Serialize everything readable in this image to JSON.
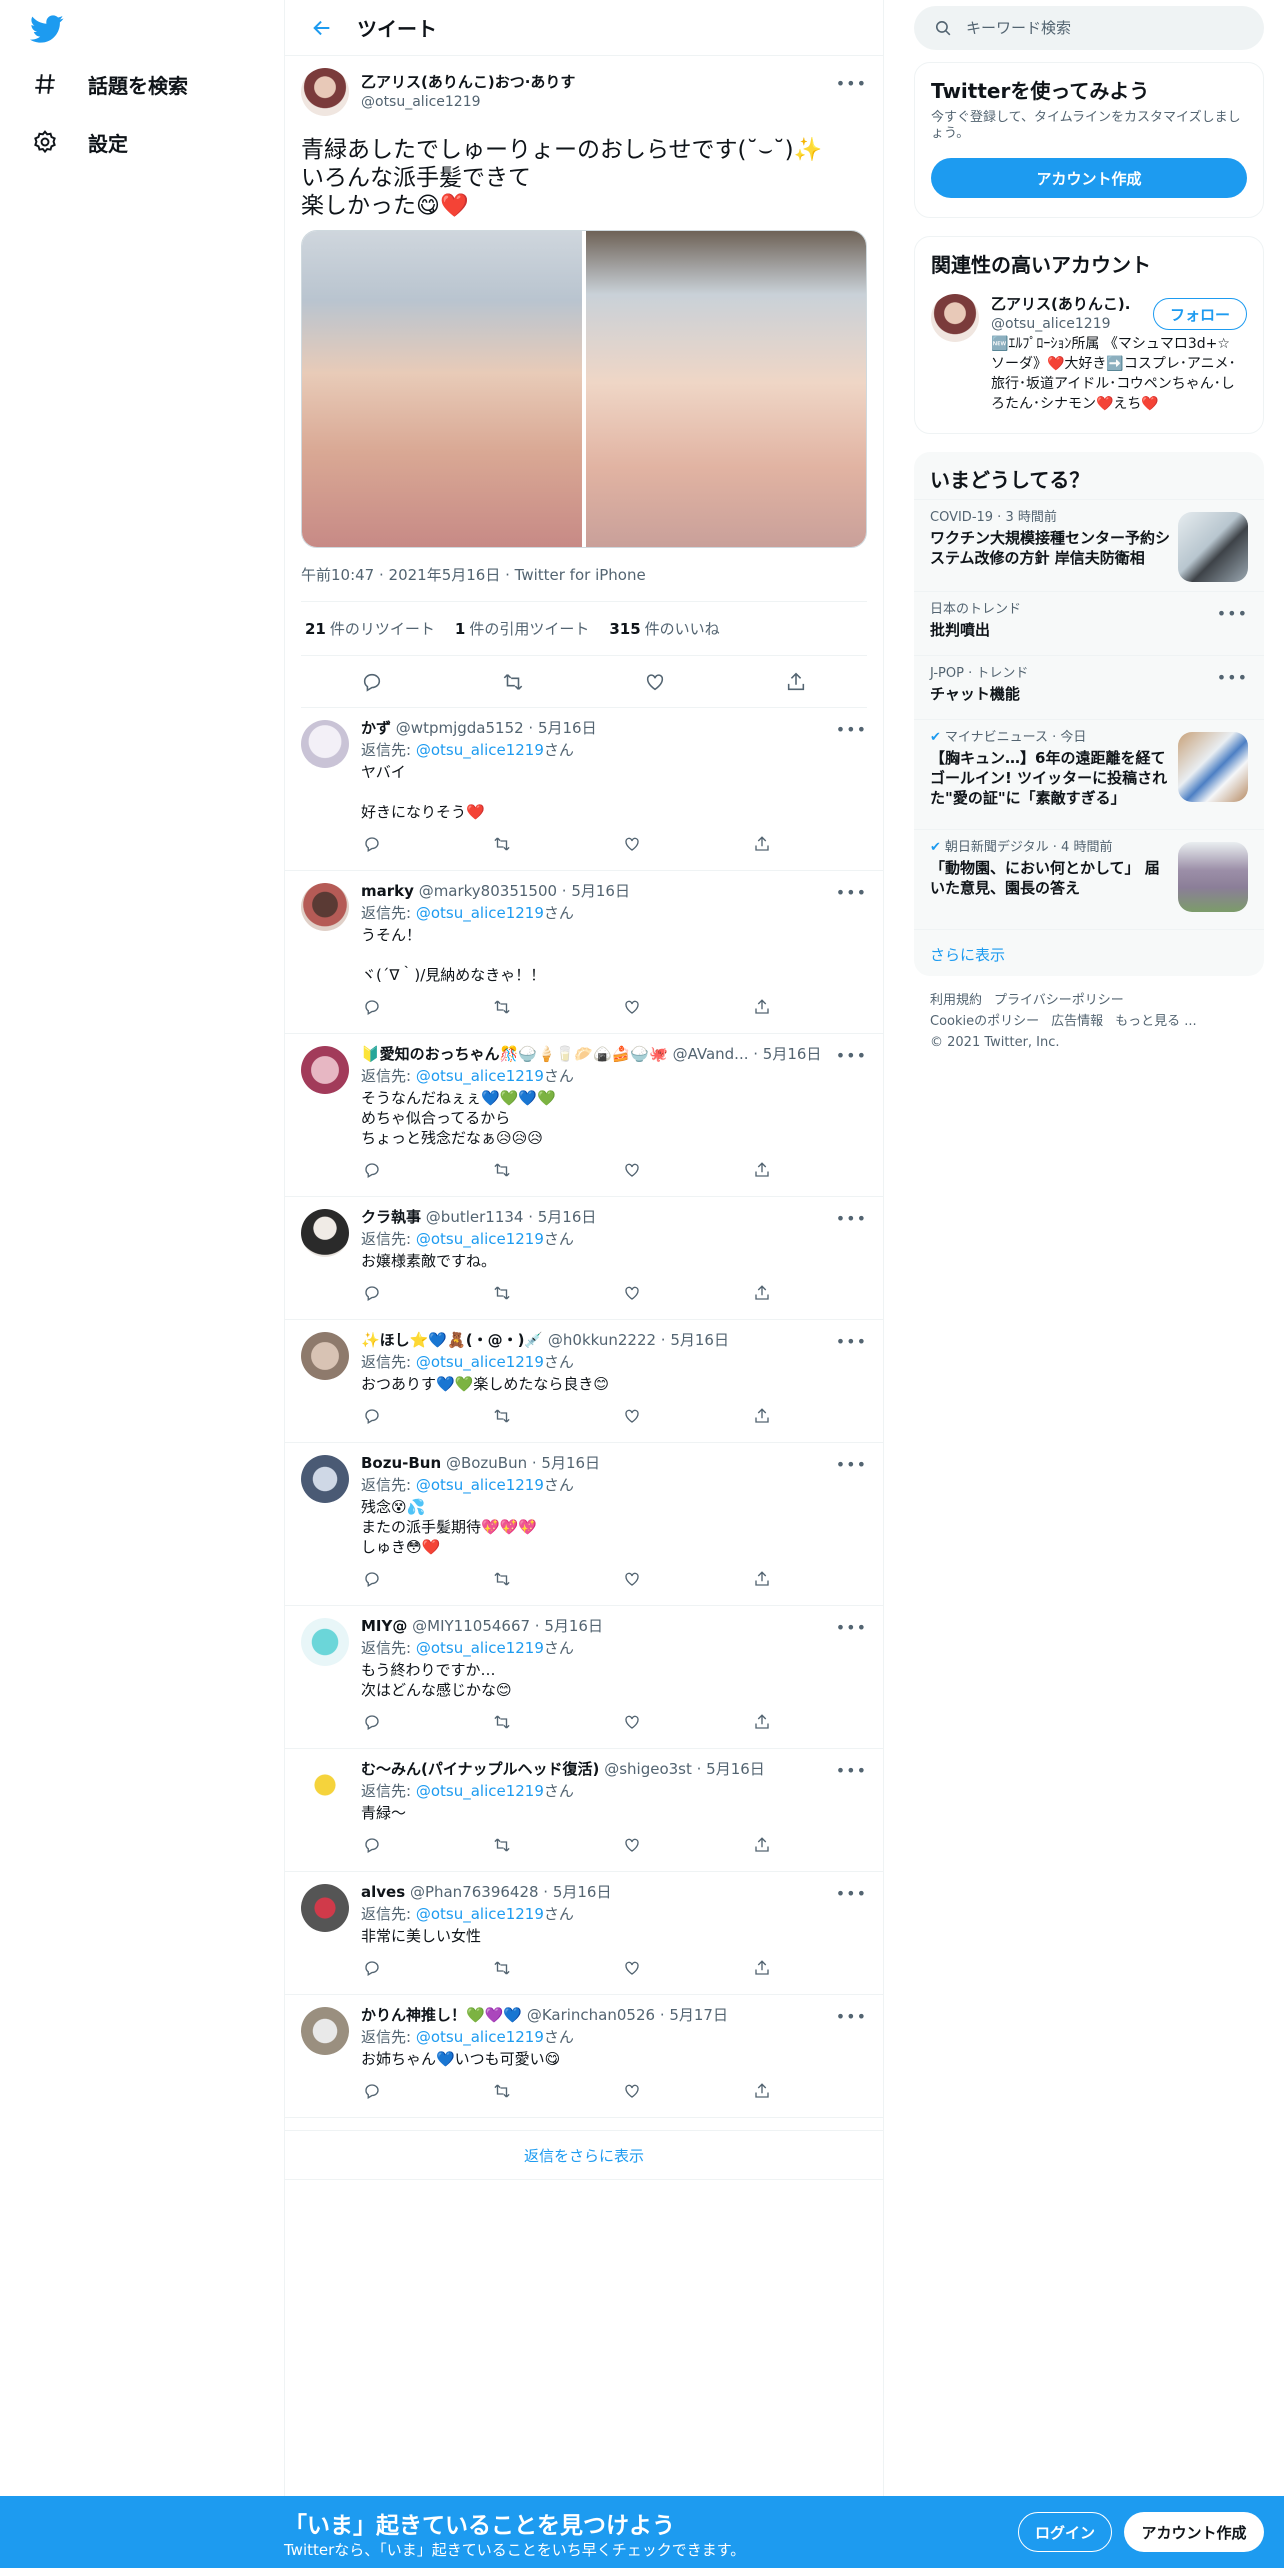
{
  "nav": {
    "items": [
      {
        "label": "話題を検索",
        "icon": "hashtag-icon"
      },
      {
        "label": "設定",
        "icon": "gear-icon"
      }
    ]
  },
  "header": {
    "title": "ツイート"
  },
  "main_tweet": {
    "display_name": "乙アリス(ありんこ)おつ·ありす",
    "handle": "@otsu_alice1219",
    "text": "青緑あしたでしゅーりょーのおしらせです(˘⌣˘)✨\nいろんな派手髪できて\n楽しかった😋❤️",
    "timestamp": "午前10:47 · 2021年5月16日 · Twitter for iPhone",
    "retweets_count": "21",
    "retweets_label": "件のリツイート",
    "quotes_count": "1",
    "quotes_label": "件の引用ツイート",
    "likes_count": "315",
    "likes_label": "件のいいね"
  },
  "replies": [
    {
      "name": "かず",
      "meta": "@wtpmjgda5152 · 5月16日",
      "reply_prefix": "返信先: ",
      "mention": "@otsu_alice1219",
      "reply_suffix": "さん",
      "text": "ヤバイ\n\n好きになりそう❤️"
    },
    {
      "name": "marky",
      "meta": "@marky80351500 · 5月16日",
      "reply_prefix": "返信先: ",
      "mention": "@otsu_alice1219",
      "reply_suffix": "さん",
      "text": "うそん！\n\nヾ(´∇｀)/見納めなきゃ！！"
    },
    {
      "name": "🔰愛知のおっちゃん🎊🍚🍦🥛🥟🍙🍰🍚🐙",
      "meta": "@AVand... · 5月16日",
      "reply_prefix": "返信先: ",
      "mention": "@otsu_alice1219",
      "reply_suffix": "さん",
      "text": "そうなんだねぇぇ💙💚💙💚\nめちゃ似合ってるから\nちょっと残念だなぁ😥😥😥"
    },
    {
      "name": "クラ執事",
      "meta": "@butler1134 · 5月16日",
      "reply_prefix": "返信先: ",
      "mention": "@otsu_alice1219",
      "reply_suffix": "さん",
      "text": "お嬢様素敵ですね。"
    },
    {
      "name": "✨ほし⭐💙🧸(・@・)💉",
      "meta": "@h0kkun2222 · 5月16日",
      "reply_prefix": "返信先: ",
      "mention": "@otsu_alice1219",
      "reply_suffix": "さん",
      "text": "おつありす💙💚楽しめたなら良き😊"
    },
    {
      "name": "Bozu-Bun",
      "meta": "@BozuBun · 5月16日",
      "reply_prefix": "返信先: ",
      "mention": "@otsu_alice1219",
      "reply_suffix": "さん",
      "text": "残念😵💦\nまたの派手髪期待💖💖💖\nしゅき😳❤️"
    },
    {
      "name": "MIY@",
      "meta": "@MIY11054667 · 5月16日",
      "reply_prefix": "返信先: ",
      "mention": "@otsu_alice1219",
      "reply_suffix": "さん",
      "text": "もう終わりですか…\n次はどんな感じかな😊"
    },
    {
      "name": "む〜みん(パイナップルヘッド復活)",
      "meta": "@shigeo3st · 5月16日",
      "reply_prefix": "返信先: ",
      "mention": "@otsu_alice1219",
      "reply_suffix": "さん",
      "text": "青緑〜"
    },
    {
      "name": "alves",
      "meta": "@Phan76396428 · 5月16日",
      "reply_prefix": "返信先: ",
      "mention": "@otsu_alice1219",
      "reply_suffix": "さん",
      "text": "非常に美しい女性"
    },
    {
      "name": "かりん神推し！💚💜💙",
      "meta": "@Karinchan0526 · 5月17日",
      "reply_prefix": "返信先: ",
      "mention": "@otsu_alice1219",
      "reply_suffix": "さん",
      "text": "お姉ちゃん💙いつも可愛い😋"
    }
  ],
  "show_more_replies": "返信をさらに表示",
  "search": {
    "placeholder": "キーワード検索"
  },
  "signup_card": {
    "title": "Twitterを使ってみよう",
    "subtitle": "今すぐ登録して、タイムラインをカスタマイズしましょう。",
    "button": "アカウント作成"
  },
  "related": {
    "title": "関連性の高いアカウント",
    "name": "乙アリス(ありんこ)...",
    "handle": "@otsu_alice1219",
    "follow": "フォロー",
    "bio": "🆕ｴﾙﾌﾟﾛｰｼｮﾝ所属 《マシュマロ3d+☆ソーダ》❤️大好き➡️コスプレ･アニメ･旅行･坂道アイドル･コウペンちゃん･しろたん･シナモン❤️えち❤️"
  },
  "trends": {
    "title": "いまどうしてる？",
    "items": [
      {
        "meta": "COVID-19 · 3 時間前",
        "title": "ワクチン大規模接種センター予約システム改修の方針 岸信夫防衛相",
        "thumb": true
      },
      {
        "meta": "日本のトレンド",
        "title": "批判噴出",
        "thumb": false
      },
      {
        "meta": "J-POP · トレンド",
        "title": "チャット機能",
        "thumb": false
      },
      {
        "meta": "マイナビニュース · 今日",
        "title": "【胸キュン…】6年の遠距離を経てゴールイン! ツイッターに投稿された\"愛の証\"に「素敵すぎる」",
        "thumb": true
      },
      {
        "meta": "朝日新聞デジタル · 4 時間前",
        "title": "「動物園、におい何とかして」 届いた意見、園長の答え",
        "thumb": true
      }
    ],
    "show_more": "さらに表示"
  },
  "footer": {
    "links": [
      "利用規約",
      "プライバシーポリシー",
      "Cookieのポリシー",
      "広告情報",
      "もっと見る ..."
    ],
    "copyright": "© 2021 Twitter, Inc."
  },
  "banner": {
    "title": "「いま」起きていることを見つけよう",
    "subtitle": "Twitterなら、「いま」起きていることをいち早くチェックできます。",
    "login": "ログイン",
    "signup": "アカウント作成"
  },
  "colors": {
    "accent": "#1d9bf0",
    "text": "#0f1419",
    "secondary": "#536471",
    "border": "#eff3f4"
  }
}
